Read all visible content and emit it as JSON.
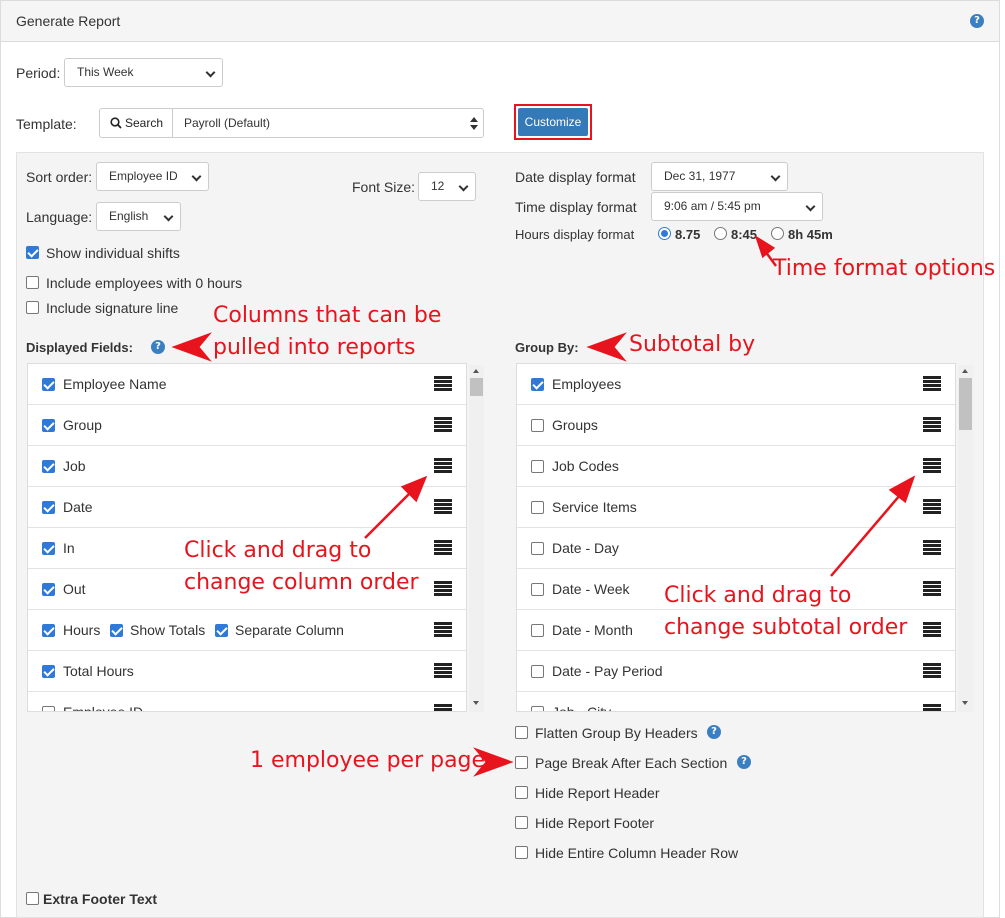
{
  "header": {
    "title": "Generate Report",
    "help_icon": "question-circle-icon"
  },
  "period": {
    "label": "Period:",
    "value": "This Week"
  },
  "template": {
    "label": "Template:",
    "search_label": "Search",
    "value": "Payroll (Default)",
    "customize_label": "Customize"
  },
  "options": {
    "sort_order": {
      "label": "Sort order:",
      "value": "Employee ID"
    },
    "font_size": {
      "label": "Font Size:",
      "value": "12"
    },
    "language": {
      "label": "Language:",
      "value": "English"
    },
    "show_shifts": {
      "label": "Show individual shifts",
      "checked": true
    },
    "include_zero": {
      "label": "Include employees with 0 hours",
      "checked": false
    },
    "include_signature": {
      "label": "Include signature line",
      "checked": false
    },
    "date_format": {
      "label": "Date display format",
      "value": "Dec 31, 1977"
    },
    "time_format": {
      "label": "Time display format",
      "value": "9:06 am / 5:45 pm"
    },
    "hours_format": {
      "label": "Hours display format",
      "options": [
        "8.75",
        "8:45",
        "8h 45m"
      ],
      "selected": "8.75"
    }
  },
  "displayed_fields": {
    "label": "Displayed Fields:",
    "rows": [
      {
        "label": "Employee Name",
        "checked": true
      },
      {
        "label": "Group",
        "checked": true
      },
      {
        "label": "Job",
        "checked": true
      },
      {
        "label": "Date",
        "checked": true
      },
      {
        "label": "In",
        "checked": true
      },
      {
        "label": "Out",
        "checked": true
      },
      {
        "label": "Hours",
        "checked": true,
        "extra1": "Show Totals",
        "extra2": "Separate Column"
      },
      {
        "label": "Total Hours",
        "checked": true
      },
      {
        "label": "Employee ID",
        "checked": false
      }
    ]
  },
  "group_by": {
    "label": "Group By:",
    "rows": [
      {
        "label": "Employees",
        "checked": true
      },
      {
        "label": "Groups",
        "checked": false
      },
      {
        "label": "Job Codes",
        "checked": false
      },
      {
        "label": "Service Items",
        "checked": false
      },
      {
        "label": "Date - Day",
        "checked": false
      },
      {
        "label": "Date - Week",
        "checked": false
      },
      {
        "label": "Date - Month",
        "checked": false
      },
      {
        "label": "Date - Pay Period",
        "checked": false
      },
      {
        "label": "Job - City",
        "checked": false
      }
    ]
  },
  "group_options": {
    "flatten": "Flatten Group By Headers",
    "page_break": "Page Break After Each Section",
    "hide_header": "Hide Report Header",
    "hide_footer": "Hide Report Footer",
    "hide_column_header": "Hide Entire Column Header Row"
  },
  "extra_footer": {
    "label": "Extra Footer Text"
  },
  "annotations": {
    "time_format": "Time format options",
    "columns_line1": "Columns that can be",
    "columns_line2": "pulled into reports",
    "subtotal": "Subtotal by",
    "drag_col_line1": "Click and drag to",
    "drag_col_line2": "change column order",
    "drag_sub_line1": "Click and drag to",
    "drag_sub_line2": "change subtotal order",
    "one_per_page": "1 employee per page"
  },
  "colors": {
    "accent": "#3479b8",
    "annotation": "#e8141d",
    "checkbox": "#2f7ad8"
  }
}
